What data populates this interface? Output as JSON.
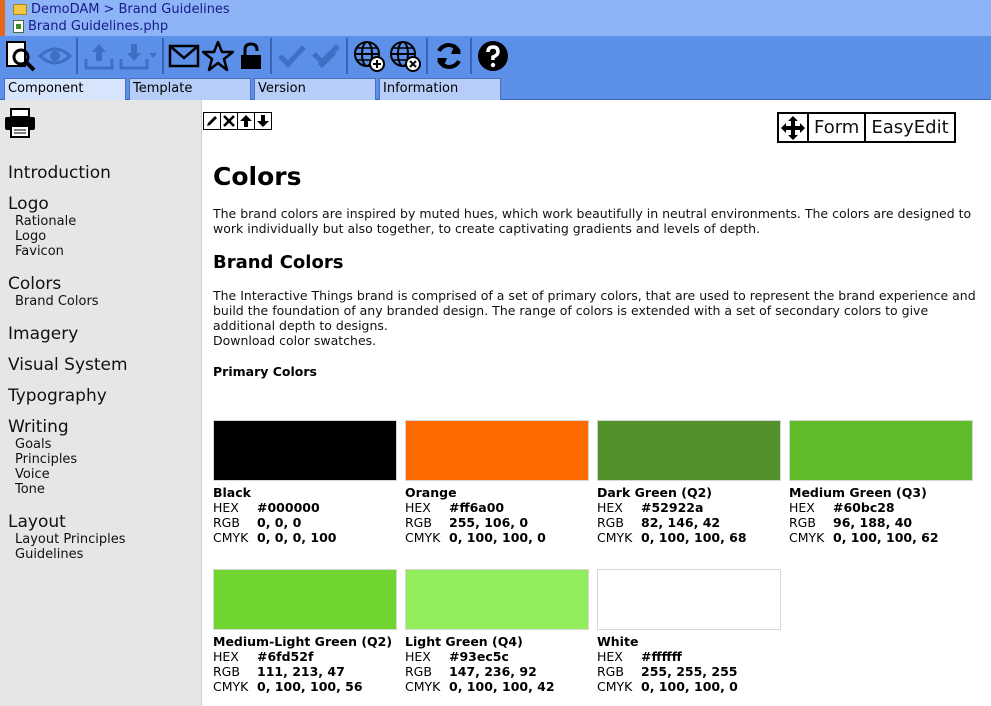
{
  "breadcrumb": {
    "app": "DemoDAM",
    "separator": ">",
    "section": "Brand Guidelines",
    "file": "Brand Guidelines.php"
  },
  "toolbar": {
    "icons": [
      "preview-icon",
      "eye-icon",
      "upload-icon",
      "download-icon",
      "email-icon",
      "star-icon",
      "lock-icon",
      "check-icon",
      "check-all-icon",
      "globe-add-icon",
      "globe-remove-icon",
      "refresh-icon",
      "help-icon"
    ]
  },
  "tabs": [
    "Component",
    "Template",
    "Version",
    "Information"
  ],
  "sidebar": {
    "sections": [
      {
        "label": "Introduction",
        "items": []
      },
      {
        "label": "Logo",
        "items": [
          "Rationale",
          "Logo",
          "Favicon"
        ]
      },
      {
        "label": "Colors",
        "items": [
          "Brand Colors"
        ]
      },
      {
        "label": "Imagery",
        "items": []
      },
      {
        "label": "Visual System",
        "items": []
      },
      {
        "label": "Typography",
        "items": []
      },
      {
        "label": "Writing",
        "items": [
          "Goals",
          "Principles",
          "Voice",
          "Tone"
        ]
      },
      {
        "label": "Layout",
        "items": [
          "Layout Principles",
          "Guidelines"
        ]
      }
    ]
  },
  "main": {
    "mode_buttons": [
      "Form",
      "EasyEdit"
    ],
    "title": "Colors",
    "intro": "The brand colors are inspired by muted hues, which work beautifully in neutral environments. The colors are designed to work individually but also together, to create captivating gradients and levels of depth.",
    "brand_heading": "Brand Colors",
    "brand_text": "The Interactive Things brand is comprised of a set of primary colors, that are used to represent the brand experience and build the foundation of any branded design. The range of colors is extended with a set of secondary colors to give additional depth to designs.",
    "download_text": "Download color swatches.",
    "primary_heading": "Primary Colors",
    "labels": {
      "hex": "HEX",
      "rgb": "RGB",
      "cmyk": "CMYK"
    },
    "swatches": [
      {
        "name": "Black",
        "hex": "#000000",
        "rgb": "0, 0, 0",
        "cmyk": "0, 0, 0, 100",
        "color": "#000000"
      },
      {
        "name": "Orange",
        "hex": "#ff6a00",
        "rgb": "255, 106, 0",
        "cmyk": "0, 100, 100, 0",
        "color": "#ff6a00"
      },
      {
        "name": "Dark Green (Q2)",
        "hex": "#52922a",
        "rgb": "82, 146, 42",
        "cmyk": "0, 100, 100, 68",
        "color": "#52922a"
      },
      {
        "name": "Medium Green (Q3)",
        "hex": "#60bc28",
        "rgb": "96, 188, 40",
        "cmyk": "0, 100, 100, 62",
        "color": "#60bc28"
      },
      {
        "name": "Medium-Light Green (Q2)",
        "hex": "#6fd52f",
        "rgb": "111, 213, 47",
        "cmyk": "0, 100, 100, 56",
        "color": "#6fd52f"
      },
      {
        "name": "Light Green (Q4)",
        "hex": "#93ec5c",
        "rgb": "147, 236, 92",
        "cmyk": "0, 100, 100, 42",
        "color": "#93ec5c"
      },
      {
        "name": "White",
        "hex": "#ffffff",
        "rgb": "255, 255, 255",
        "cmyk": "0, 100, 100, 0",
        "color": "#ffffff"
      }
    ]
  },
  "colors": {
    "header_bg": "#8cb4f7",
    "toolbar_bg": "#5b8fe8",
    "sidebar_bg": "#e6e6e6",
    "accent": "#e5671c"
  }
}
